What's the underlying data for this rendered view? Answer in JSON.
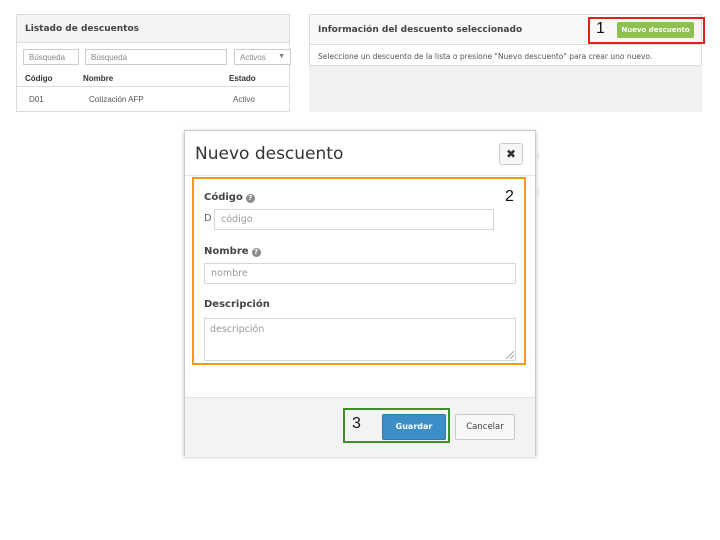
{
  "list_panel": {
    "title": "Listado de descuentos",
    "filters": {
      "code_placeholder": "Búsqueda",
      "name_placeholder": "Búsqueda",
      "state_value": "Activos"
    },
    "columns": [
      "Código",
      "Nombre",
      "Estado"
    ],
    "rows": [
      {
        "code": "D01",
        "name": "Cotización AFP",
        "state": "Activo"
      }
    ]
  },
  "info_panel": {
    "title": "Información del descuento seleccionado",
    "message": "Seleccione un descuento de la lista o presione \"Nuevo descuento\" para crear uno nuevo.",
    "new_button_label": "Nuevo descuento"
  },
  "callouts": [
    "1",
    "2",
    "3"
  ],
  "modal": {
    "title": "Nuevo descuento",
    "close_glyph": "✖",
    "code": {
      "label": "Código",
      "prefix": "D",
      "placeholder": "código"
    },
    "name": {
      "label": "Nombre",
      "placeholder": "nombre"
    },
    "description": {
      "label": "Descripción",
      "placeholder": "descripción"
    },
    "help_glyph": "?",
    "save_label": "Guardar",
    "cancel_label": "Cancelar"
  },
  "colors": {
    "new_button": "#8dc04f",
    "save_button": "#3d8ec6",
    "callout_1": "#e0201b",
    "callout_2": "#f39a19",
    "callout_3": "#3f8f2b"
  },
  "icons": {
    "state_dropdown": "chevron-down-icon",
    "close": "close-icon",
    "help": "help-icon",
    "resize": "resize-grip-icon"
  }
}
